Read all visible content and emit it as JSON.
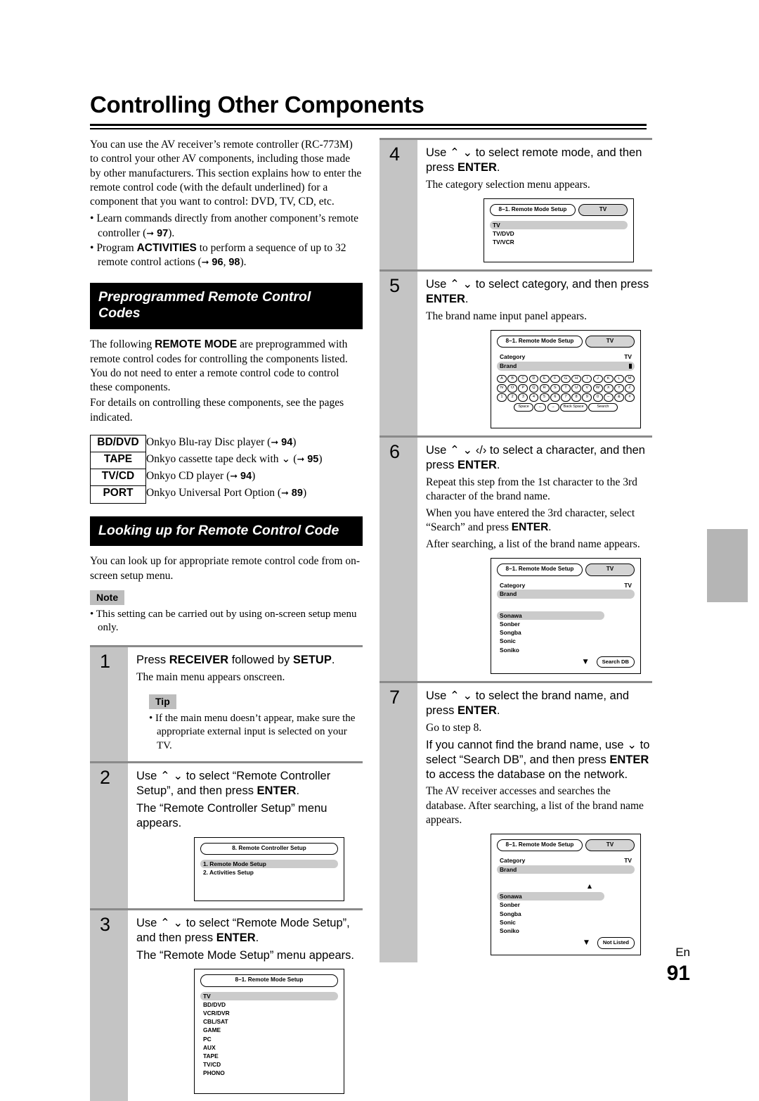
{
  "page": {
    "title": "Controlling Other Components",
    "footer_lang": "En",
    "footer_number": "91"
  },
  "intro": {
    "paragraph": "You can use the AV receiver’s remote controller (RC-773M) to control your other AV components, including those made by other manufacturers. This section explains how to enter the remote control code (with the default underlined) for a component that you want to control: DVD, TV, CD, etc.",
    "bullets": [
      {
        "text_before": "Learn commands directly from another component’s remote controller (",
        "bold": "",
        "text_after": "",
        "page_ref": "97",
        "tail": ")."
      },
      {
        "text_before": "Program ",
        "bold": "ACTIVITIES",
        "text_after": " to perform a sequence of up to 32 remote control actions (",
        "page_ref": "96",
        "page_ref2": "98",
        "tail": ")."
      }
    ]
  },
  "section_preprogrammed": {
    "heading": "Preprogrammed Remote Control Codes",
    "paragraph1_a": "The following ",
    "paragraph1_bold": "REMOTE MODE",
    "paragraph1_b": " are preprogrammed with remote control codes for controlling the components listed. You do not need to enter a remote control code to control these components.",
    "paragraph2": "For details on controlling these components, see the pages indicated.",
    "modes": [
      {
        "key": "BD/DVD",
        "desc": "Onkyo Blu-ray Disc player (",
        "page_ref": "94",
        "tail": ")"
      },
      {
        "key": "TAPE",
        "desc": "Onkyo cassette tape deck with ",
        "symbol": "⌄",
        "desc2": " (",
        "page_ref": "95",
        "tail": ")"
      },
      {
        "key": "TV/CD",
        "desc": "Onkyo CD player (",
        "page_ref": "94",
        "tail": ")"
      },
      {
        "key": "PORT",
        "desc": "Onkyo Universal Port Option (",
        "page_ref": "89",
        "tail": ")"
      }
    ]
  },
  "section_lookup": {
    "heading": "Looking up for Remote Control Code",
    "paragraph": "You can look up for appropriate remote control code from on-screen setup menu.",
    "note_badge": "Note",
    "note_items": [
      "This setting can be carried out by using on-screen setup menu only."
    ]
  },
  "steps": {
    "step1": {
      "number": "1",
      "head_a": "Press ",
      "head_bold1": "RECEIVER",
      "head_b": " followed by ",
      "head_bold2": "SETUP",
      "head_c": ".",
      "sub": "The main menu appears onscreen.",
      "tip_badge": "Tip",
      "tip_items": [
        "If the main menu doesn’t appear, make sure the appropriate external input is selected on your TV."
      ]
    },
    "step2": {
      "number": "2",
      "head_a": "Use ",
      "head_keys": "⌃ ⌄",
      "head_b": " to select “Remote Controller Setup”, and then press ",
      "head_bold": "ENTER",
      "head_c": ".",
      "sub": "The “Remote Controller Setup” menu appears."
    },
    "step3": {
      "number": "3",
      "head_a": "Use ",
      "head_keys": "⌃ ⌄",
      "head_b": " to select “Remote Mode Setup”, and then press ",
      "head_bold": "ENTER",
      "head_c": ".",
      "sub": "The “Remote Mode Setup” menu appears."
    },
    "step4": {
      "number": "4",
      "head_a": "Use ",
      "head_keys": "⌃ ⌄",
      "head_b": " to select remote mode, and then press ",
      "head_bold": "ENTER",
      "head_c": ".",
      "sub": "The category selection menu appears."
    },
    "step5": {
      "number": "5",
      "head_a": "Use ",
      "head_keys": "⌃ ⌄",
      "head_b": " to select category, and then press ",
      "head_bold": "ENTER",
      "head_c": ".",
      "sub": "The brand name input panel appears."
    },
    "step6": {
      "number": "6",
      "head_a": "Use ",
      "head_keys": "⌃ ⌄ ‹/›",
      "head_b": " to select a character, and then press ",
      "head_bold": "ENTER",
      "head_c": ".",
      "sub1": "Repeat this step from the 1st character to the 3rd character of the brand name.",
      "sub2_a": "When you have entered the 3rd character, select “Search” and press ",
      "sub2_bold": "ENTER",
      "sub2_b": ".",
      "sub3": "After searching, a list of the brand name appears."
    },
    "step7": {
      "number": "7",
      "head_a": "Use ",
      "head_keys": "⌃ ⌄",
      "head_b": " to select the brand name, and press ",
      "head_bold": "ENTER",
      "head_c": ".",
      "sub1": "Go to step 8.",
      "sub2_a": "If you cannot find the brand name, use ",
      "sub2_key": "⌄",
      "sub2_b": " to select “Search DB”, and then press ",
      "sub2_bold": "ENTER",
      "sub2_c": " to access the database on the network.",
      "sub3": "The AV receiver accesses and searches the database. After searching, a list of the brand name appears."
    }
  },
  "osd": {
    "remote_controller_setup": {
      "title": "8.   Remote Controller Setup",
      "items": [
        {
          "label": "1.   Remote Mode Setup",
          "selected": true
        },
        {
          "label": "2.   Activities Setup",
          "selected": false
        }
      ]
    },
    "remote_mode_setup": {
      "title": "8–1.  Remote Mode Setup",
      "items": [
        {
          "label": "TV",
          "selected": true
        },
        {
          "label": "BD/DVD",
          "selected": false
        },
        {
          "label": "VCR/DVR",
          "selected": false
        },
        {
          "label": "CBL/SAT",
          "selected": false
        },
        {
          "label": "GAME",
          "selected": false
        },
        {
          "label": "PC",
          "selected": false
        },
        {
          "label": "AUX",
          "selected": false
        },
        {
          "label": "TAPE",
          "selected": false
        },
        {
          "label": "TV/CD",
          "selected": false
        },
        {
          "label": "PHONO",
          "selected": false
        }
      ]
    },
    "category_select": {
      "title": "8–1.  Remote Mode Setup",
      "mode": "TV",
      "items": [
        {
          "label": "TV",
          "selected": true
        },
        {
          "label": "TV/DVD",
          "selected": false
        },
        {
          "label": "TV/VCR",
          "selected": false
        }
      ]
    },
    "brand_input": {
      "title": "8–1.  Remote Mode Setup",
      "mode": "TV",
      "rows": [
        {
          "label": "Category",
          "value": "TV",
          "selected": false
        },
        {
          "label": "Brand",
          "value": "",
          "selected": true
        }
      ],
      "keyboard": {
        "row1": [
          "A",
          "B",
          "C",
          "D",
          "E",
          "F",
          "G",
          "H",
          "I",
          "J",
          "K",
          "L",
          "M"
        ],
        "row2": [
          "N",
          "O",
          "P",
          "Q",
          "R",
          "S",
          "T",
          "U",
          "V",
          "W",
          "X",
          "Y",
          "Z"
        ],
        "row3": [
          "1",
          "2",
          "3",
          "4",
          "5",
          "6",
          "7",
          "8",
          "9",
          "0",
          "–",
          "&",
          "#"
        ],
        "row4": [
          "Space",
          "←",
          "→",
          "Back Space",
          "Search"
        ]
      }
    },
    "brand_list_search": {
      "title": "8–1.  Remote Mode Setup",
      "mode": "TV",
      "rows": [
        {
          "label": "Category",
          "value": "TV",
          "selected": false
        },
        {
          "label": "Brand",
          "value": "",
          "selected": true
        }
      ],
      "brands": [
        {
          "label": "Sonawa",
          "selected": true
        },
        {
          "label": "Sonber",
          "selected": false
        },
        {
          "label": "Songba",
          "selected": false
        },
        {
          "label": "Sonic",
          "selected": false
        },
        {
          "label": "Soniko",
          "selected": false
        }
      ],
      "scroll_down": "▼",
      "button": "Search DB"
    },
    "brand_list_db": {
      "title": "8–1.  Remote Mode Setup",
      "mode": "TV",
      "rows": [
        {
          "label": "Category",
          "value": "TV",
          "selected": false
        },
        {
          "label": "Brand",
          "value": "",
          "selected": true
        }
      ],
      "scroll_up": "▲",
      "brands": [
        {
          "label": "Sonawa",
          "selected": true
        },
        {
          "label": "Sonber",
          "selected": false
        },
        {
          "label": "Songba",
          "selected": false
        },
        {
          "label": "Sonic",
          "selected": false
        },
        {
          "label": "Soniko",
          "selected": false
        }
      ],
      "scroll_down": "▼",
      "button": "Not Listed"
    }
  }
}
